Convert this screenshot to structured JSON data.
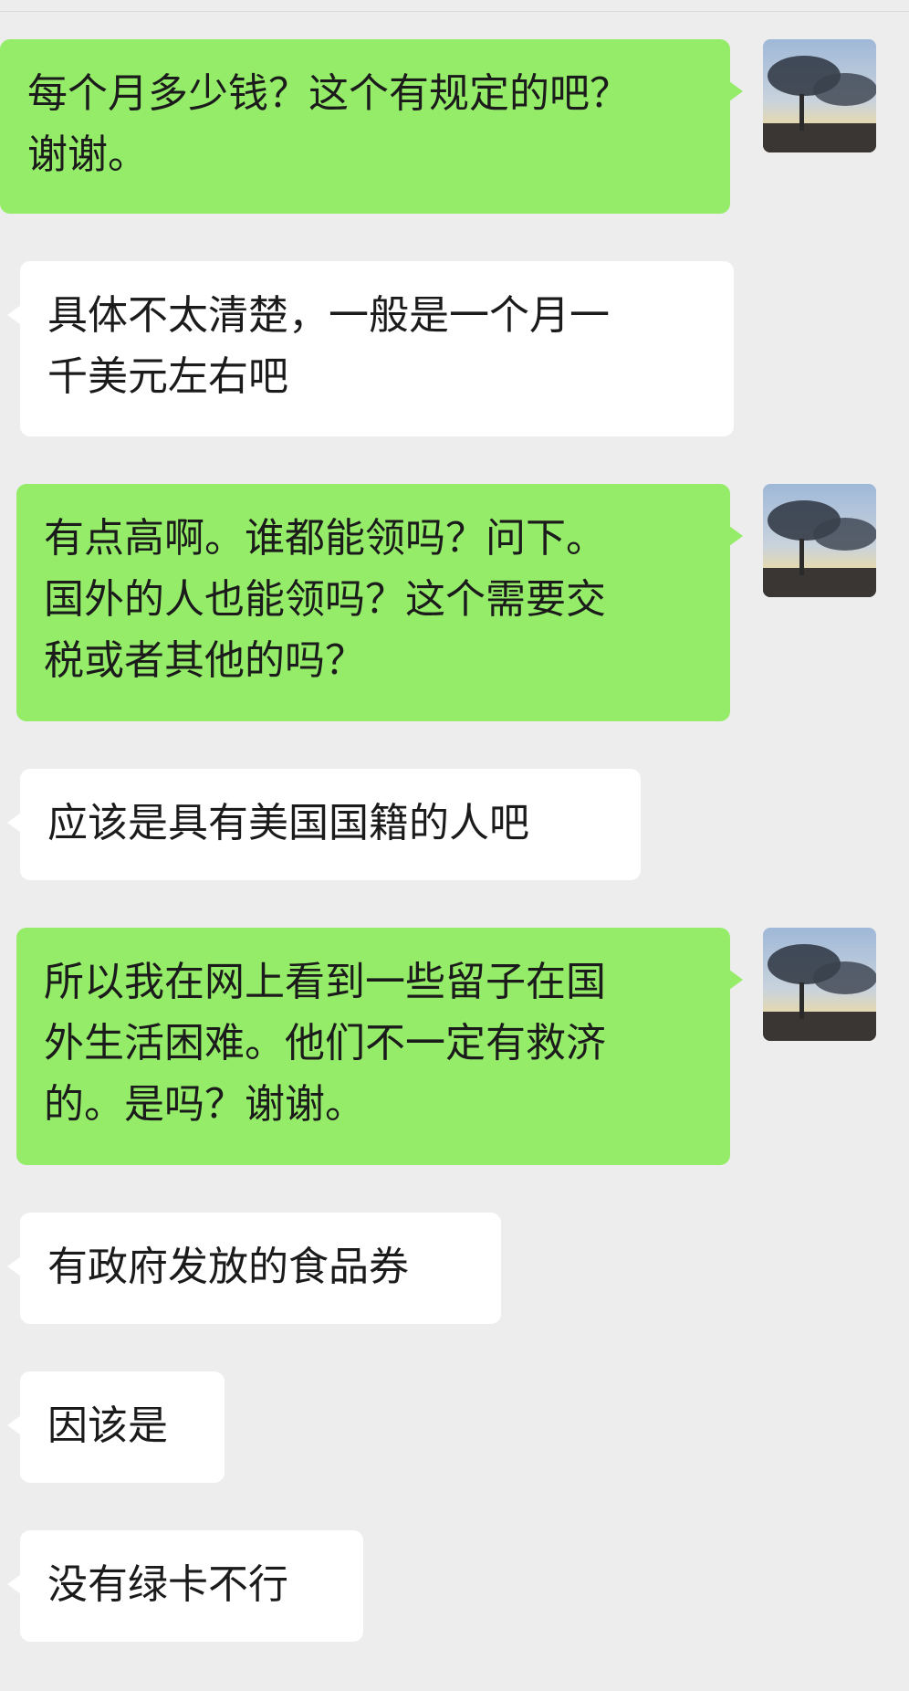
{
  "chat": {
    "messages": [
      {
        "direction": "outgoing",
        "text": "每个月多少钱？这个有规定的吧？\n谢谢。"
      },
      {
        "direction": "incoming",
        "text": "具体不太清楚，一般是一个月一\n千美元左右吧"
      },
      {
        "direction": "outgoing",
        "text": "有点高啊。谁都能领吗？问下。\n国外的人也能领吗？这个需要交\n税或者其他的吗？"
      },
      {
        "direction": "incoming",
        "text": "应该是具有美国国籍的人吧"
      },
      {
        "direction": "outgoing",
        "text": "所以我在网上看到一些留子在国\n外生活困难。他们不一定有救济\n的。是吗？谢谢。"
      },
      {
        "direction": "incoming",
        "text": "有政府发放的食品券"
      },
      {
        "direction": "incoming",
        "text": "因该是"
      },
      {
        "direction": "incoming",
        "text": "没有绿卡不行"
      }
    ]
  },
  "colors": {
    "background": "#ededed",
    "outgoing_bubble": "#95ec69",
    "incoming_bubble": "#ffffff",
    "text": "#1b1b1b"
  }
}
